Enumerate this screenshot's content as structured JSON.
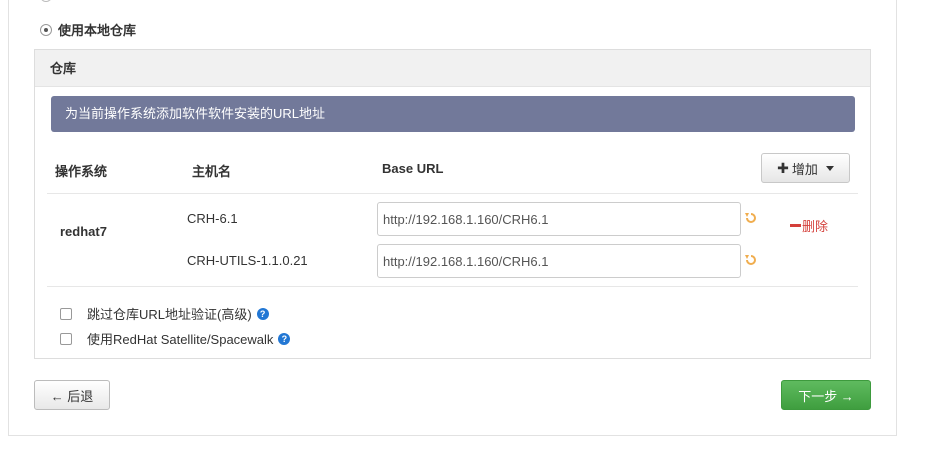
{
  "repo_option": {
    "label": "使用本地仓库",
    "selected": true
  },
  "panel": {
    "title": "仓库",
    "info_text": "为当前操作系统添加软件软件安装的URL地址",
    "columns": {
      "os": "操作系统",
      "hostname": "主机名",
      "base_url": "Base URL"
    },
    "add_button_label": "增加",
    "os_groups": [
      {
        "os": "redhat7",
        "delete_label": "删除",
        "repos": [
          {
            "name": "CRH-6.1",
            "base_url": "http://192.168.1.160/CRH6.1"
          },
          {
            "name": "CRH-UTILS-1.1.0.21",
            "base_url": "http://192.168.1.160/CRH6.1"
          }
        ]
      }
    ],
    "options": [
      {
        "label": "跳过仓库URL地址验证(高级)",
        "checked": false
      },
      {
        "label": "使用RedHat Satellite/Spacewalk",
        "checked": false
      }
    ]
  },
  "footer": {
    "back_label": "← 后退",
    "next_label": "下一步 →"
  },
  "colors": {
    "info_bar": "#72799a",
    "delete": "#d43f3a",
    "next_button": "#4cae4c",
    "undo_icon": "#f0ad4e",
    "help_icon": "#2277d4"
  },
  "icons": {
    "undo": "undo-icon",
    "help": "question-circle-icon",
    "add": "plus-icon",
    "remove": "minus-icon"
  }
}
